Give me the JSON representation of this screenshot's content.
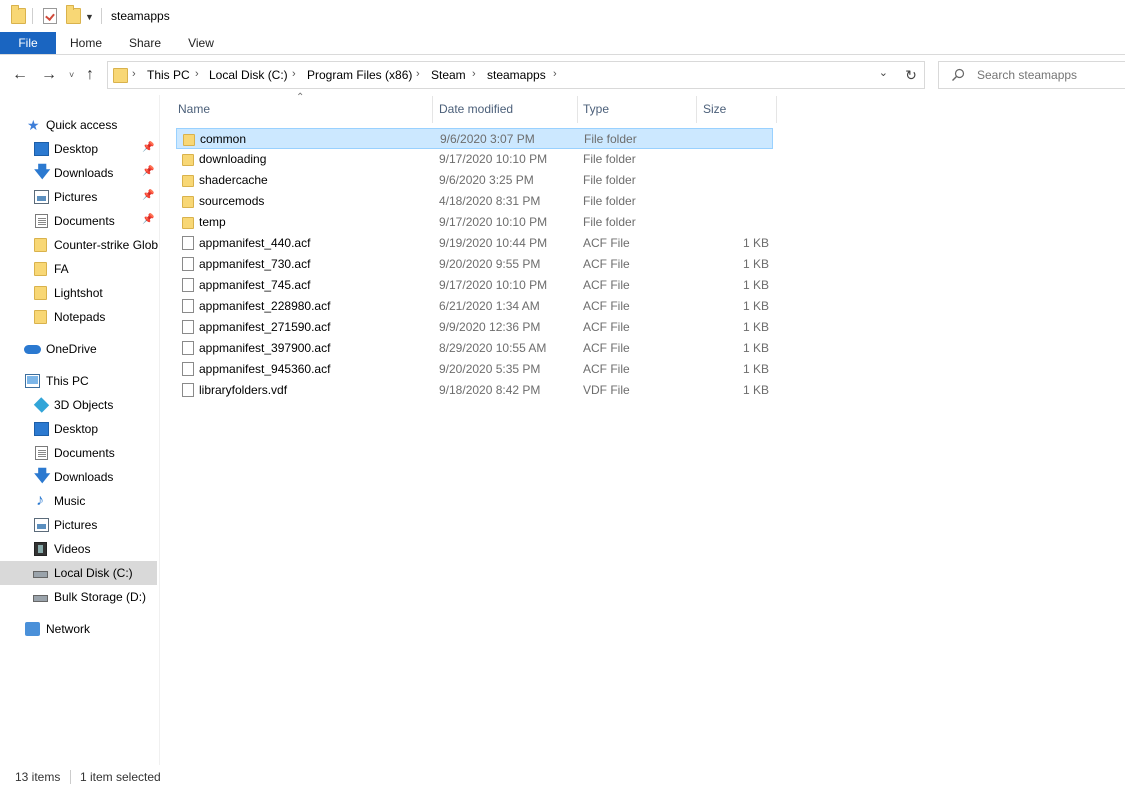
{
  "window": {
    "title": "steamapps"
  },
  "ribbon": {
    "tabs": [
      "File",
      "Home",
      "Share",
      "View"
    ]
  },
  "address": {
    "breadcrumbs": [
      "This PC",
      "Local Disk (C:)",
      "Program Files (x86)",
      "Steam",
      "steamapps"
    ]
  },
  "search": {
    "placeholder": "Search steamapps"
  },
  "sidebar": {
    "items": [
      {
        "label": "Quick access",
        "icon": "star-icon",
        "pinned": false
      },
      {
        "label": "Desktop",
        "icon": "desktop-icon",
        "pinned": true
      },
      {
        "label": "Downloads",
        "icon": "download-icon",
        "pinned": true
      },
      {
        "label": "Pictures",
        "icon": "pictures-icon",
        "pinned": true
      },
      {
        "label": "Documents",
        "icon": "documents-icon",
        "pinned": true
      },
      {
        "label": "Counter-strike  Glob",
        "icon": "folder-icon",
        "pinned": false
      },
      {
        "label": "FA",
        "icon": "folder-icon",
        "pinned": false
      },
      {
        "label": "Lightshot",
        "icon": "folder-icon",
        "pinned": false
      },
      {
        "label": "Notepads",
        "icon": "folder-icon",
        "pinned": false
      },
      {
        "label": "OneDrive",
        "icon": "cloud-icon",
        "pinned": false
      },
      {
        "label": "This PC",
        "icon": "computer-icon",
        "pinned": false
      },
      {
        "label": "3D Objects",
        "icon": "cube-icon",
        "pinned": false
      },
      {
        "label": "Desktop",
        "icon": "desktop-icon",
        "pinned": false
      },
      {
        "label": "Documents",
        "icon": "documents-icon",
        "pinned": false
      },
      {
        "label": "Downloads",
        "icon": "download-icon",
        "pinned": false
      },
      {
        "label": "Music",
        "icon": "music-icon",
        "pinned": false
      },
      {
        "label": "Pictures",
        "icon": "pictures-icon",
        "pinned": false
      },
      {
        "label": "Videos",
        "icon": "video-icon",
        "pinned": false
      },
      {
        "label": "Local Disk (C:)",
        "icon": "disk-icon",
        "pinned": false,
        "selected": true
      },
      {
        "label": "Bulk Storage (D:)",
        "icon": "disk-icon",
        "pinned": false
      },
      {
        "label": "Network",
        "icon": "network-icon",
        "pinned": false
      }
    ]
  },
  "columns": [
    "Name",
    "Date modified",
    "Type",
    "Size"
  ],
  "files": [
    {
      "name": "common",
      "date": "9/6/2020 3:07 PM",
      "type": "File folder",
      "size": "",
      "kind": "folder",
      "selected": true
    },
    {
      "name": "downloading",
      "date": "9/17/2020 10:10 PM",
      "type": "File folder",
      "size": "",
      "kind": "folder"
    },
    {
      "name": "shadercache",
      "date": "9/6/2020 3:25 PM",
      "type": "File folder",
      "size": "",
      "kind": "folder"
    },
    {
      "name": "sourcemods",
      "date": "4/18/2020 8:31 PM",
      "type": "File folder",
      "size": "",
      "kind": "folder"
    },
    {
      "name": "temp",
      "date": "9/17/2020 10:10 PM",
      "type": "File folder",
      "size": "",
      "kind": "folder"
    },
    {
      "name": "appmanifest_440.acf",
      "date": "9/19/2020 10:44 PM",
      "type": "ACF File",
      "size": "1 KB",
      "kind": "file"
    },
    {
      "name": "appmanifest_730.acf",
      "date": "9/20/2020 9:55 PM",
      "type": "ACF File",
      "size": "1 KB",
      "kind": "file"
    },
    {
      "name": "appmanifest_745.acf",
      "date": "9/17/2020 10:10 PM",
      "type": "ACF File",
      "size": "1 KB",
      "kind": "file"
    },
    {
      "name": "appmanifest_228980.acf",
      "date": "6/21/2020 1:34 AM",
      "type": "ACF File",
      "size": "1 KB",
      "kind": "file"
    },
    {
      "name": "appmanifest_271590.acf",
      "date": "9/9/2020 12:36 PM",
      "type": "ACF File",
      "size": "1 KB",
      "kind": "file"
    },
    {
      "name": "appmanifest_397900.acf",
      "date": "8/29/2020 10:55 AM",
      "type": "ACF File",
      "size": "1 KB",
      "kind": "file"
    },
    {
      "name": "appmanifest_945360.acf",
      "date": "9/20/2020 5:35 PM",
      "type": "ACF File",
      "size": "1 KB",
      "kind": "file"
    },
    {
      "name": "libraryfolders.vdf",
      "date": "9/18/2020 8:42 PM",
      "type": "VDF File",
      "size": "1 KB",
      "kind": "file"
    }
  ],
  "status": {
    "count": "13 items",
    "selection": "1 item selected"
  },
  "colors": {
    "accent": "#1a65c1",
    "selection": "#cce8ff",
    "selection_border": "#99d1ff",
    "folder": "#f8d775"
  }
}
